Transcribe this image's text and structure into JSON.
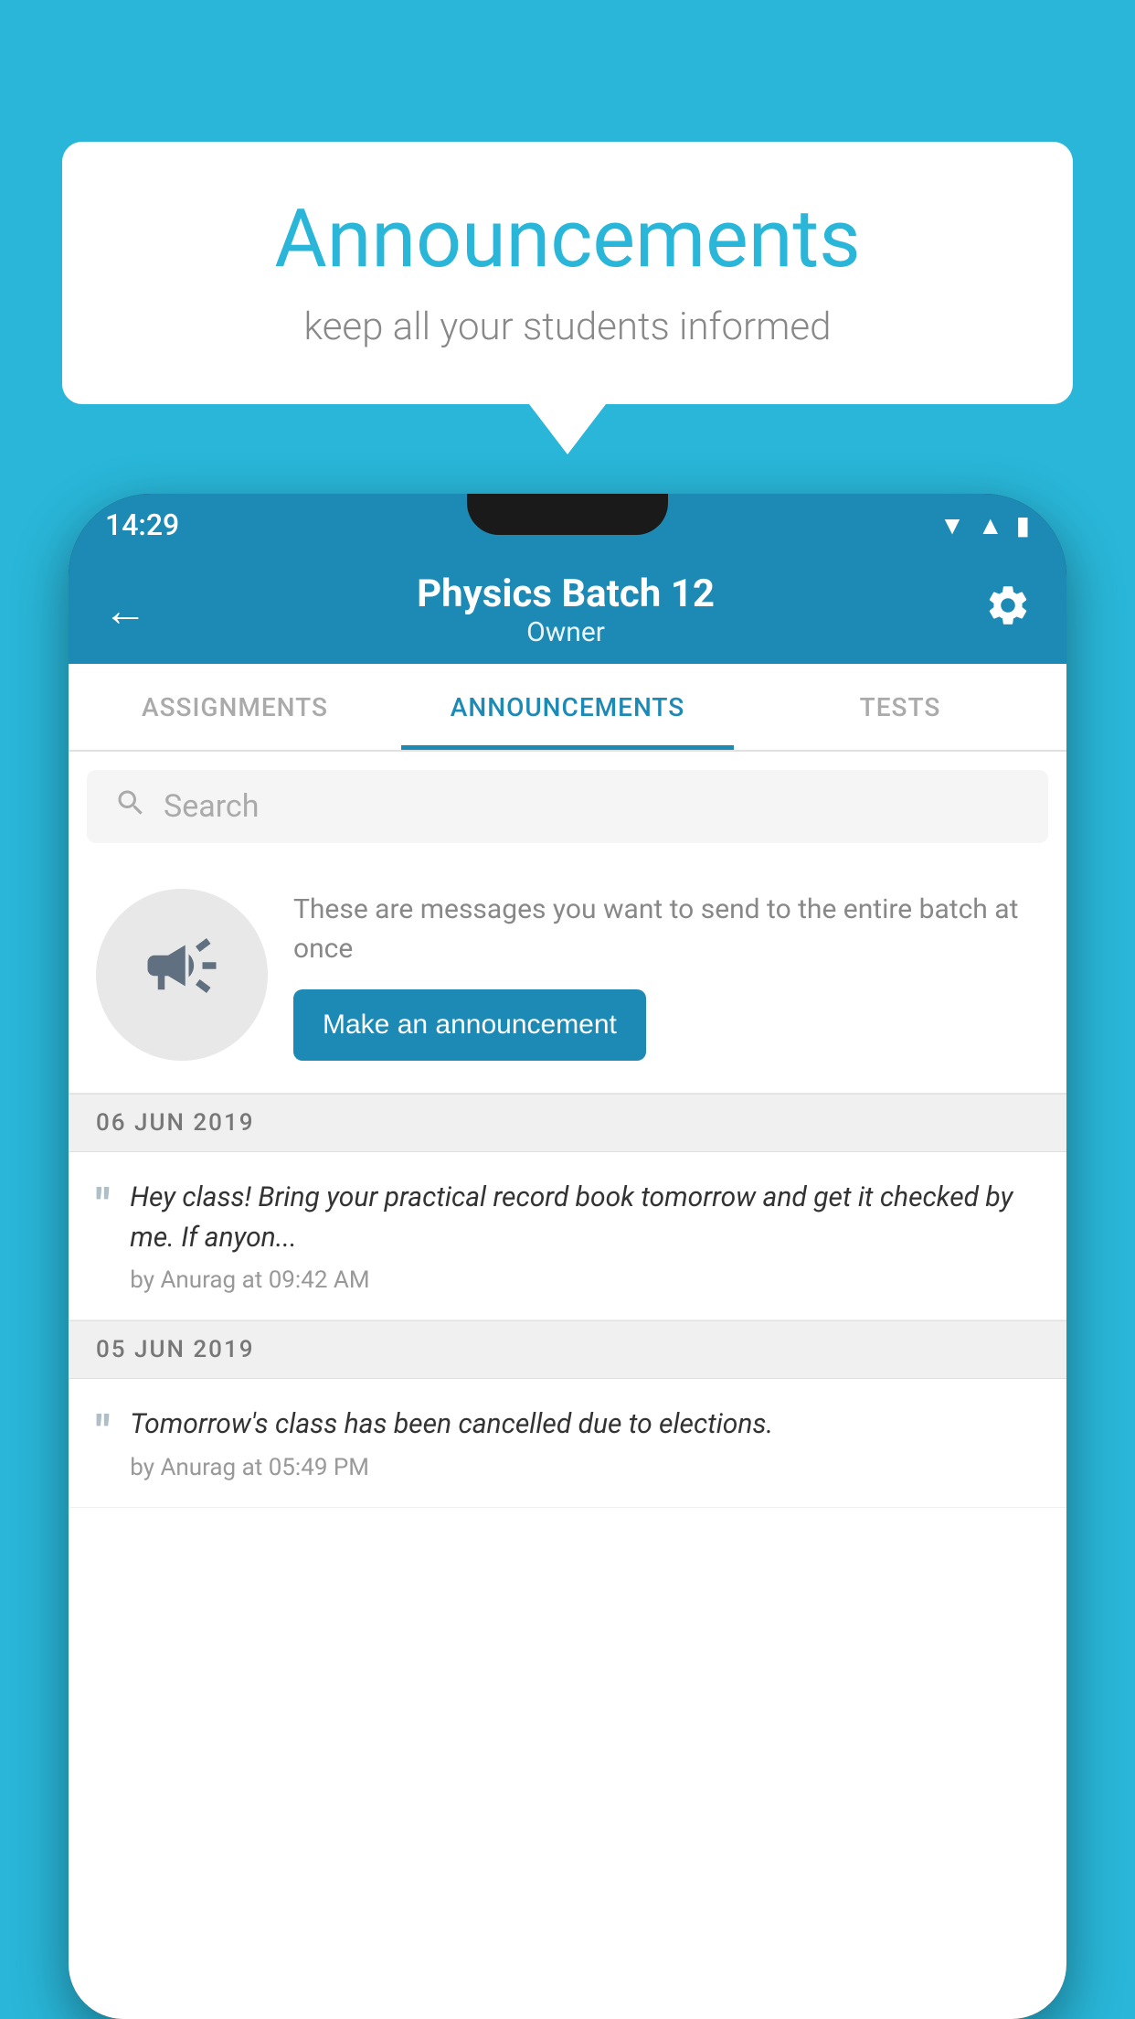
{
  "background_color": "#29b6d8",
  "speech_bubble": {
    "title": "Announcements",
    "subtitle": "keep all your students informed"
  },
  "status_bar": {
    "time": "14:29"
  },
  "app_bar": {
    "title": "Physics Batch 12",
    "subtitle": "Owner",
    "back_label": "←",
    "settings_label": "⚙"
  },
  "tabs": [
    {
      "label": "ASSIGNMENTS",
      "active": false
    },
    {
      "label": "ANNOUNCEMENTS",
      "active": true
    },
    {
      "label": "TESTS",
      "active": false
    }
  ],
  "search": {
    "placeholder": "Search"
  },
  "announcement_prompt": {
    "description": "These are messages you want to send to the entire batch at once",
    "button_label": "Make an announcement"
  },
  "announcements": [
    {
      "date": "06  JUN  2019",
      "text": "Hey class! Bring your practical record book tomorrow and get it checked by me. If anyon...",
      "meta": "by Anurag at 09:42 AM"
    },
    {
      "date": "05  JUN  2019",
      "text": "Tomorrow's class has been cancelled due to elections.",
      "meta": "by Anurag at 05:49 PM"
    }
  ]
}
